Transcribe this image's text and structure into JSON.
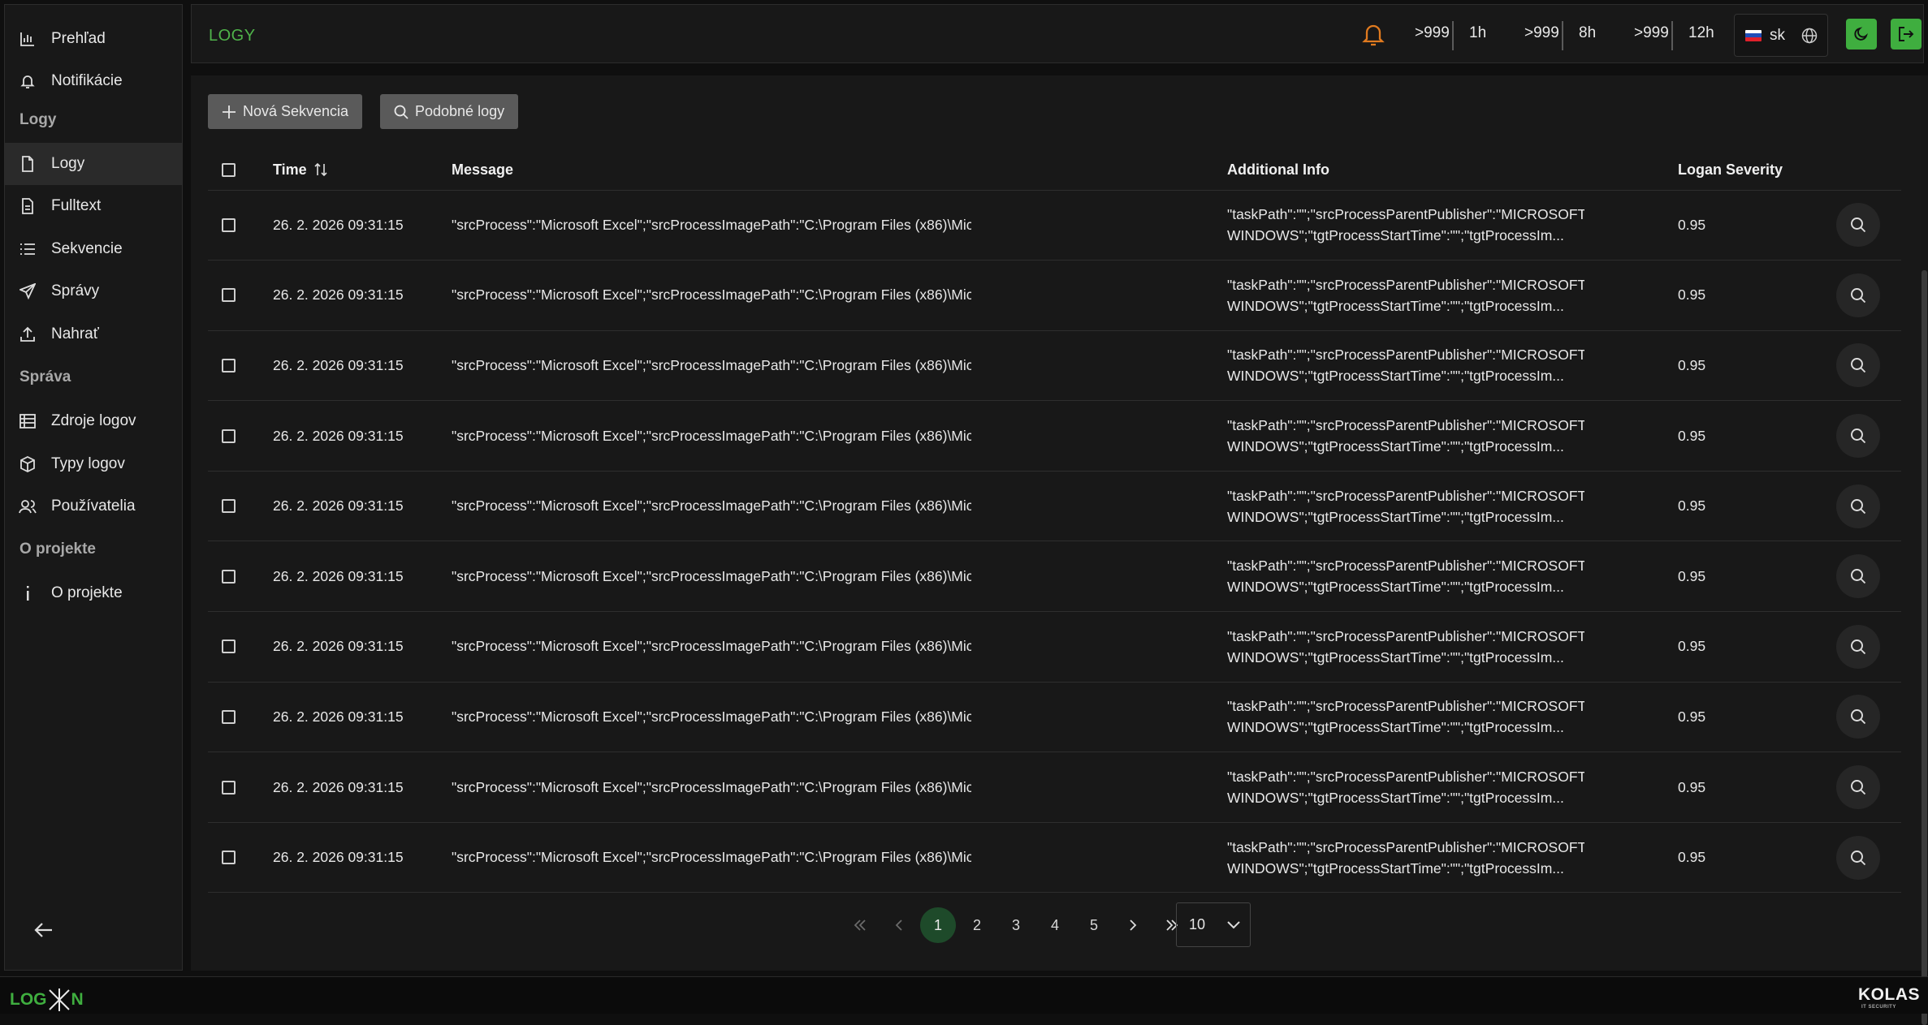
{
  "sidebar": {
    "items": [
      {
        "label": "Prehľad",
        "icon": "bar-chart-icon"
      },
      {
        "label": "Notifikácie",
        "icon": "bell-icon"
      },
      {
        "label": "Logy",
        "icon": "file-icon"
      },
      {
        "label": "Fulltext",
        "icon": "file-icon"
      },
      {
        "label": "Sekvencie",
        "icon": "list-icon"
      },
      {
        "label": "Správy",
        "icon": "send-icon"
      },
      {
        "label": "Nahrať",
        "icon": "upload-icon"
      },
      {
        "label": "Zdroje logov",
        "icon": "table-icon"
      },
      {
        "label": "Typy logov",
        "icon": "box-icon"
      },
      {
        "label": "Používatelia",
        "icon": "users-icon"
      },
      {
        "label": "O projekte",
        "icon": "info-icon"
      }
    ],
    "sections": [
      "Logy",
      "Správa",
      "O projekte"
    ],
    "active_item": "Logy"
  },
  "header": {
    "title": "LOGY",
    "counters": [
      {
        "count": ">999",
        "period": "1h"
      },
      {
        "count": ">999",
        "period": "8h"
      },
      {
        "count": ">999",
        "period": "12h"
      }
    ],
    "language": "sk",
    "accent_color": "#3fae3f",
    "bell_color": "#e07a1f"
  },
  "toolbar": {
    "new_sequence_label": "Nová Sekvencia",
    "similar_logs_label": "Podobné logy"
  },
  "table": {
    "columns": [
      "Time",
      "Message",
      "Additional Info",
      "Logan Severity"
    ],
    "rows": [
      {
        "time": "26. 2. 2026 09:31:15",
        "message": "\"srcProcess\":\"Microsoft Excel\";\"srcProcessImagePath\":\"C:\\Program Files (x86)\\Microsoft Office\\root\\O...",
        "info": "\"taskPath\":\"\";\"srcProcessParentPublisher\":\"MICROSOFT WINDOWS\";\"tgtProcessStartTime\":\"\";\"tgtProcessIm...",
        "severity": "0.95"
      },
      {
        "time": "26. 2. 2026 09:31:15",
        "message": "\"srcProcess\":\"Microsoft Excel\";\"srcProcessImagePath\":\"C:\\Program Files (x86)\\Microsoft Office\\root\\O...",
        "info": "\"taskPath\":\"\";\"srcProcessParentPublisher\":\"MICROSOFT WINDOWS\";\"tgtProcessStartTime\":\"\";\"tgtProcessIm...",
        "severity": "0.95"
      },
      {
        "time": "26. 2. 2026 09:31:15",
        "message": "\"srcProcess\":\"Microsoft Excel\";\"srcProcessImagePath\":\"C:\\Program Files (x86)\\Microsoft Office\\root\\O...",
        "info": "\"taskPath\":\"\";\"srcProcessParentPublisher\":\"MICROSOFT WINDOWS\";\"tgtProcessStartTime\":\"\";\"tgtProcessIm...",
        "severity": "0.95"
      },
      {
        "time": "26. 2. 2026 09:31:15",
        "message": "\"srcProcess\":\"Microsoft Excel\";\"srcProcessImagePath\":\"C:\\Program Files (x86)\\Microsoft Office\\root\\O...",
        "info": "\"taskPath\":\"\";\"srcProcessParentPublisher\":\"MICROSOFT WINDOWS\";\"tgtProcessStartTime\":\"\";\"tgtProcessIm...",
        "severity": "0.95"
      },
      {
        "time": "26. 2. 2026 09:31:15",
        "message": "\"srcProcess\":\"Microsoft Excel\";\"srcProcessImagePath\":\"C:\\Program Files (x86)\\Microsoft Office\\root\\O...",
        "info": "\"taskPath\":\"\";\"srcProcessParentPublisher\":\"MICROSOFT WINDOWS\";\"tgtProcessStartTime\":\"\";\"tgtProcessIm...",
        "severity": "0.95"
      },
      {
        "time": "26. 2. 2026 09:31:15",
        "message": "\"srcProcess\":\"Microsoft Excel\";\"srcProcessImagePath\":\"C:\\Program Files (x86)\\Microsoft Office\\root\\O...",
        "info": "\"taskPath\":\"\";\"srcProcessParentPublisher\":\"MICROSOFT WINDOWS\";\"tgtProcessStartTime\":\"\";\"tgtProcessIm...",
        "severity": "0.95"
      },
      {
        "time": "26. 2. 2026 09:31:15",
        "message": "\"srcProcess\":\"Microsoft Excel\";\"srcProcessImagePath\":\"C:\\Program Files (x86)\\Microsoft Office\\root\\O...",
        "info": "\"taskPath\":\"\";\"srcProcessParentPublisher\":\"MICROSOFT WINDOWS\";\"tgtProcessStartTime\":\"\";\"tgtProcessIm...",
        "severity": "0.95"
      },
      {
        "time": "26. 2. 2026 09:31:15",
        "message": "\"srcProcess\":\"Microsoft Excel\";\"srcProcessImagePath\":\"C:\\Program Files (x86)\\Microsoft Office\\root\\O...",
        "info": "\"taskPath\":\"\";\"srcProcessParentPublisher\":\"MICROSOFT WINDOWS\";\"tgtProcessStartTime\":\"\";\"tgtProcessIm...",
        "severity": "0.95"
      },
      {
        "time": "26. 2. 2026 09:31:15",
        "message": "\"srcProcess\":\"Microsoft Excel\";\"srcProcessImagePath\":\"C:\\Program Files (x86)\\Microsoft Office\\root\\O...",
        "info": "\"taskPath\":\"\";\"srcProcessParentPublisher\":\"MICROSOFT WINDOWS\";\"tgtProcessStartTime\":\"\";\"tgtProcessIm...",
        "severity": "0.95"
      },
      {
        "time": "26. 2. 2026 09:31:15",
        "message": "\"srcProcess\":\"Microsoft Excel\";\"srcProcessImagePath\":\"C:\\Program Files (x86)\\Microsoft Office\\root\\O...",
        "info": "\"taskPath\":\"\";\"srcProcessParentPublisher\":\"MICROSOFT WINDOWS\";\"tgtProcessStartTime\":\"\";\"tgtProcessIm...",
        "severity": "0.95"
      }
    ]
  },
  "pagination": {
    "pages": [
      "1",
      "2",
      "3",
      "4",
      "5"
    ],
    "current_page": "1",
    "per_page": "10"
  },
  "footer": {
    "logo_left": "LOG",
    "logo_left_suffix": "N",
    "logo_right": "KOLAS",
    "logo_right_tagline": "IT SECURITY"
  }
}
